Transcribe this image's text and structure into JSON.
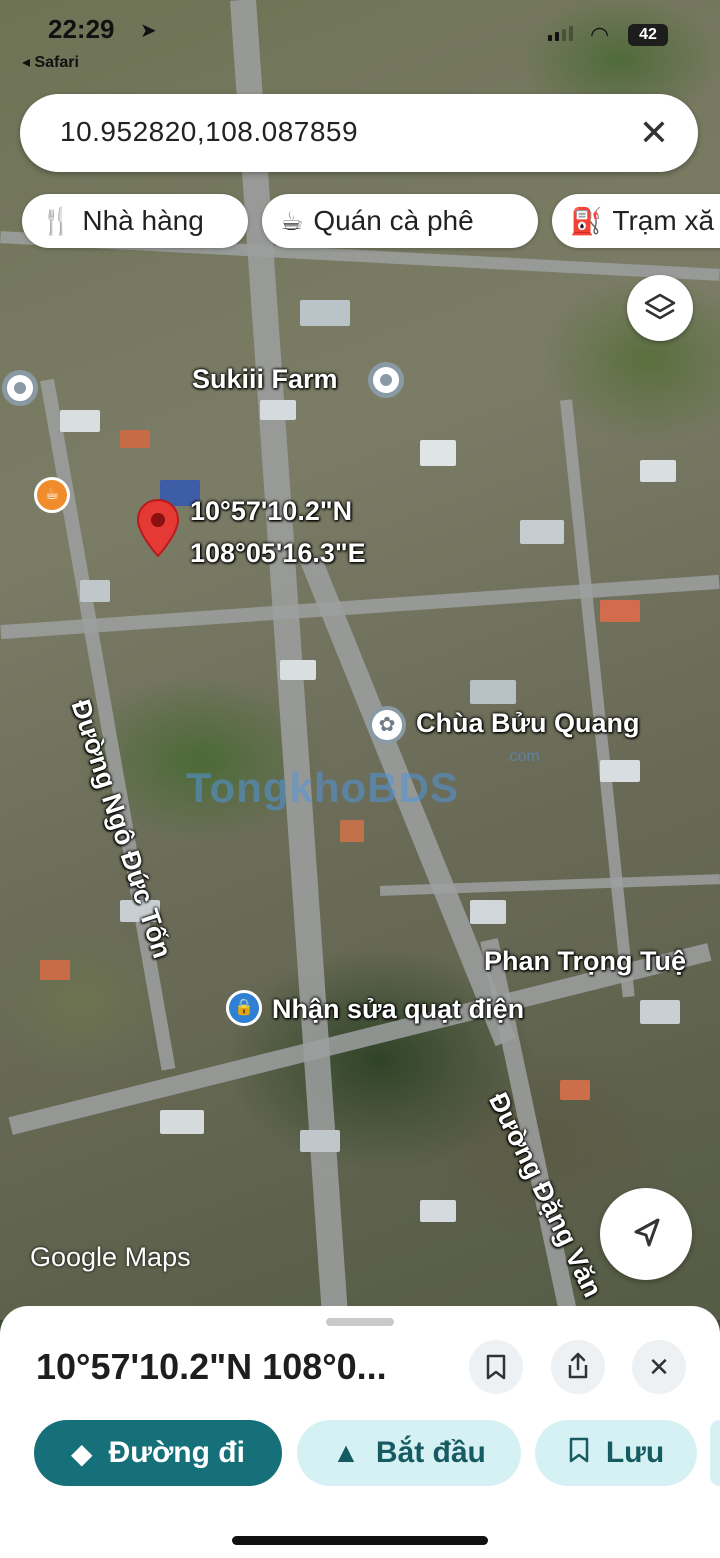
{
  "status_bar": {
    "time": "22:29",
    "back_app": "Safari",
    "battery": "42"
  },
  "search": {
    "value": "10.952820,108.087859"
  },
  "chips": [
    {
      "label": "Nhà hàng",
      "icon": "restaurant-icon"
    },
    {
      "label": "Quán cà phê",
      "icon": "coffee-icon"
    },
    {
      "label": "Trạm xă",
      "icon": "gas-station-icon"
    }
  ],
  "map": {
    "pin_coords_line1": "10°57'10.2\"N",
    "pin_coords_line2": "108°05'16.3\"E",
    "places": {
      "sukiii": "Sukiii Farm",
      "chua": "Chùa Bửu Quang",
      "phan": "Phan Trọng Tuệ",
      "quat": "Nhận sửa quạt điện",
      "road_ngo": "Đường Ngô Đức Tốn",
      "road_dang": "Đường Đặng Văn"
    },
    "watermark": "TongkhoBDS",
    "watermark_suffix": ".com",
    "attribution": "Google Maps"
  },
  "sheet": {
    "title": "10°57'10.2\"N 108°0...",
    "actions": {
      "directions": "Đường đi",
      "start": "Bắt đầu",
      "save": "Lưu"
    }
  }
}
